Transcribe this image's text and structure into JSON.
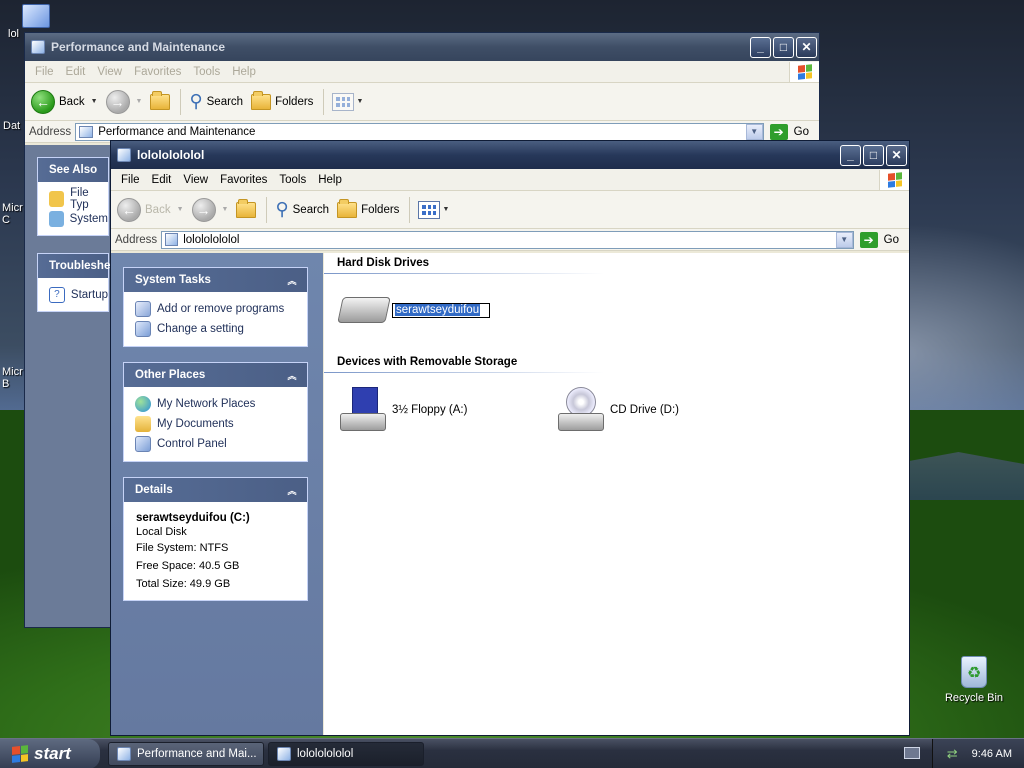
{
  "desktop": {
    "icons": [
      {
        "label": "lol"
      },
      {
        "label": "Dat"
      },
      {
        "label": "Micr\nC"
      },
      {
        "label": "Micr\nB"
      },
      {
        "label": "Recycle Bin"
      }
    ]
  },
  "bg_window": {
    "title": "Performance and Maintenance",
    "menu": [
      "File",
      "Edit",
      "View",
      "Favorites",
      "Tools",
      "Help"
    ],
    "toolbar": {
      "back": "Back",
      "search": "Search",
      "folders": "Folders"
    },
    "address_label": "Address",
    "address_value": "Performance and Maintenance",
    "go_label": "Go",
    "panels": [
      {
        "title": "See Also",
        "items": [
          "File Typ",
          "System"
        ]
      },
      {
        "title": "Troubleshe",
        "items": [
          "Startup"
        ]
      }
    ]
  },
  "window": {
    "title": "lolololololol",
    "menu": [
      "File",
      "Edit",
      "View",
      "Favorites",
      "Tools",
      "Help"
    ],
    "toolbar": {
      "back": "Back",
      "search": "Search",
      "folders": "Folders"
    },
    "address_label": "Address",
    "address_value": "lolololololol",
    "go_label": "Go",
    "system_tasks": {
      "title": "System Tasks",
      "items": [
        "Add or remove programs",
        "Change a setting"
      ]
    },
    "other_places": {
      "title": "Other Places",
      "items": [
        "My Network Places",
        "My Documents",
        "Control Panel"
      ]
    },
    "details": {
      "title": "Details",
      "name": "serawtseyduifou (C:)",
      "type": "Local Disk",
      "file_system": "File System: NTFS",
      "free_space": "Free Space: 40.5 GB",
      "total_size": "Total Size: 49.9 GB"
    },
    "content": {
      "hard_disk_header": "Hard Disk Drives",
      "hard_disk_rename": "serawtseyduifou",
      "removable_header": "Devices with Removable Storage",
      "floppy_label": "3½ Floppy (A:)",
      "cd_label": "CD Drive (D:)"
    }
  },
  "taskbar": {
    "start_label": "start",
    "tasks": [
      "Performance and Mai...",
      "lolololololol"
    ],
    "clock": "9:46 AM"
  }
}
